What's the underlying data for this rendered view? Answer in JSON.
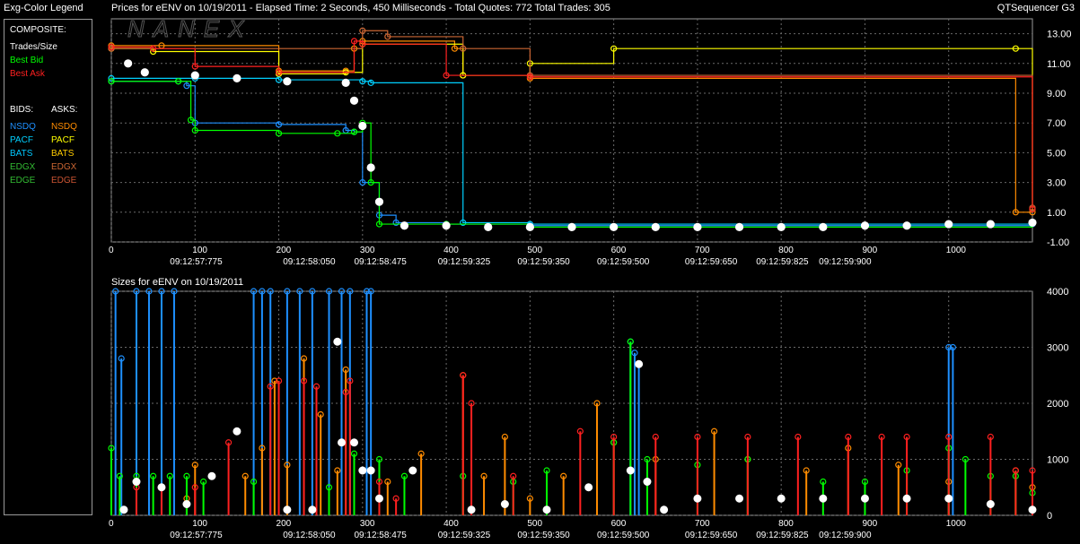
{
  "legend": {
    "title": "Exg-Color Legend",
    "composite_label": "COMPOSITE:",
    "trades_size": "Trades/Size",
    "best_bid": "Best Bid",
    "best_ask": "Best Ask",
    "bids_label": "BIDS:",
    "asks_label": "ASKS:",
    "bids": [
      "NSDQ",
      "PACF",
      "BATS",
      "EDGX",
      "EDGE"
    ],
    "asks": [
      "NSDQ",
      "PACF",
      "BATS",
      "EDGX",
      "EDGE"
    ],
    "colors": {
      "trades": "#ffffff",
      "best_bid": "#00ff00",
      "best_ask": "#ff2020",
      "bid_colors": [
        "#1e90ff",
        "#00d0ff",
        "#00c8ff",
        "#33bb33",
        "#33bb33"
      ],
      "ask_colors": [
        "#ff8c00",
        "#ffff00",
        "#ffcc00",
        "#cc6633",
        "#cc5533"
      ]
    }
  },
  "header": {
    "prices_title": "Prices for  eENV  on  10/19/2011   -  Elapsed Time: 2 Seconds, 450 Milliseconds   -  Total Quotes: 772  Total Trades: 305",
    "app_name": "QTSequencer G3"
  },
  "chart_data": [
    {
      "type": "line",
      "title": "Prices for  eENV  on  10/19/2011",
      "watermark": "NANEX",
      "xlim": [
        0,
        1100
      ],
      "ylim": [
        -1,
        14
      ],
      "y_ticks": [
        "13.00",
        "11.00",
        "9.00",
        "7.00",
        "5.00",
        "3.00",
        "1.00",
        "-1.00"
      ],
      "y_tick_values": [
        13,
        11,
        9,
        7,
        5,
        3,
        1,
        -1
      ],
      "x_ticks": [
        0,
        100,
        200,
        300,
        400,
        500,
        600,
        700,
        800,
        900,
        1000
      ],
      "time_labels": [
        {
          "x": 70,
          "label": "09:12:57:775"
        },
        {
          "x": 205,
          "label": "09:12:58:050"
        },
        {
          "x": 290,
          "label": "09:12:58:475"
        },
        {
          "x": 390,
          "label": "09:12:59:325"
        },
        {
          "x": 485,
          "label": "09:12:59:350"
        },
        {
          "x": 580,
          "label": "09:12:59:500"
        },
        {
          "x": 685,
          "label": "09:12:59:650"
        },
        {
          "x": 770,
          "label": "09:12:59:825"
        },
        {
          "x": 845,
          "label": "09:12:59:900"
        }
      ],
      "series": [
        {
          "name": "NSDQ Ask",
          "color": "#ff8c00",
          "x": [
            0,
            60,
            200,
            280,
            290,
            300,
            410,
            420,
            500,
            1080,
            1100
          ],
          "y": [
            12.2,
            12.2,
            10.5,
            10.5,
            12.0,
            12.5,
            12.0,
            10.2,
            10.0,
            1.0,
            1.0
          ]
        },
        {
          "name": "PACF Ask",
          "color": "#ffff00",
          "x": [
            0,
            50,
            200,
            280,
            300,
            420,
            500,
            600,
            1080,
            1100
          ],
          "y": [
            12.0,
            11.8,
            10.3,
            10.4,
            12.3,
            10.2,
            11.0,
            12.0,
            12.0,
            1.2
          ]
        },
        {
          "name": "EDGX Ask",
          "color": "#cc6633",
          "x": [
            0,
            300,
            330,
            420,
            500,
            1100
          ],
          "y": [
            12.0,
            13.2,
            12.8,
            12.0,
            10.2,
            1.3
          ]
        },
        {
          "name": "NSDQ Bid",
          "color": "#1e90ff",
          "x": [
            0,
            80,
            90,
            100,
            200,
            280,
            290,
            300,
            320,
            340,
            400,
            500,
            1100
          ],
          "y": [
            9.8,
            9.8,
            9.5,
            7.0,
            6.9,
            6.5,
            6.4,
            3.0,
            0.8,
            0.3,
            0.2,
            0.1,
            0.2
          ]
        },
        {
          "name": "PACF Bid",
          "color": "#00d0ff",
          "x": [
            0,
            100,
            200,
            300,
            310,
            420,
            500,
            1100
          ],
          "y": [
            10.0,
            10.0,
            9.9,
            9.8,
            9.7,
            0.3,
            0.2,
            0.3
          ]
        },
        {
          "name": "Best Bid",
          "color": "#00ff00",
          "x": [
            0,
            80,
            95,
            100,
            200,
            270,
            290,
            300,
            310,
            320,
            400,
            500,
            1100
          ],
          "y": [
            9.8,
            9.8,
            7.2,
            6.5,
            6.3,
            6.3,
            6.4,
            7.0,
            3.0,
            0.2,
            0.2,
            0.0,
            0.3
          ]
        },
        {
          "name": "Best Ask",
          "color": "#ff2020",
          "x": [
            0,
            50,
            100,
            200,
            290,
            300,
            400,
            500,
            1100
          ],
          "y": [
            12.1,
            12.0,
            10.8,
            10.4,
            12.5,
            12.3,
            10.2,
            10.1,
            1.2
          ]
        },
        {
          "name": "Trades",
          "color": "#ffffff",
          "x": [
            20,
            40,
            100,
            150,
            210,
            280,
            290,
            300,
            310,
            320,
            350,
            400,
            450,
            500,
            550,
            600,
            650,
            700,
            750,
            800,
            850,
            900,
            950,
            1000,
            1050,
            1100
          ],
          "y": [
            11.0,
            10.4,
            10.2,
            10.0,
            9.8,
            9.7,
            8.5,
            6.8,
            4.0,
            1.7,
            0.1,
            0.1,
            0.0,
            0.0,
            0.0,
            0.0,
            0.0,
            0.0,
            0.0,
            0.0,
            0.0,
            0.1,
            0.1,
            0.2,
            0.2,
            0.3
          ]
        }
      ]
    },
    {
      "type": "bar",
      "title": "Sizes for  eENV  on  10/19/2011",
      "xlim": [
        0,
        1100
      ],
      "ylim": [
        0,
        4000
      ],
      "y_ticks": [
        "4000",
        "3000",
        "2000",
        "1000",
        "0"
      ],
      "y_tick_values": [
        4000,
        3000,
        2000,
        1000,
        0
      ],
      "x_ticks": [
        0,
        100,
        200,
        300,
        400,
        500,
        600,
        700,
        800,
        900,
        1000
      ],
      "time_labels": [
        {
          "x": 70,
          "label": "09:12:57:775"
        },
        {
          "x": 205,
          "label": "09:12:58:050"
        },
        {
          "x": 290,
          "label": "09:12:58:475"
        },
        {
          "x": 390,
          "label": "09:12:59:325"
        },
        {
          "x": 485,
          "label": "09:12:59:350"
        },
        {
          "x": 580,
          "label": "09:12:59:500"
        },
        {
          "x": 685,
          "label": "09:12:59:650"
        },
        {
          "x": 770,
          "label": "09:12:59:825"
        },
        {
          "x": 845,
          "label": "09:12:59:900"
        }
      ],
      "series": [
        {
          "name": "NSDQ Bid Size",
          "color": "#1e90ff",
          "x": [
            5,
            12,
            30,
            45,
            60,
            75,
            170,
            180,
            190,
            210,
            225,
            240,
            260,
            275,
            285,
            305,
            310,
            620,
            625,
            630,
            1000,
            1005
          ],
          "y": [
            4000,
            2800,
            4000,
            4000,
            4000,
            4000,
            4000,
            4000,
            4000,
            4000,
            4000,
            4000,
            4000,
            4000,
            4000,
            4000,
            4000,
            3100,
            2900,
            2700,
            3000,
            3000
          ]
        },
        {
          "name": "NSDQ Ask Size",
          "color": "#ff8c00",
          "x": [
            90,
            100,
            160,
            180,
            195,
            210,
            230,
            250,
            270,
            280,
            330,
            370,
            420,
            445,
            470,
            500,
            540,
            580,
            600,
            650,
            720,
            760,
            830,
            880,
            940,
            1000,
            1080,
            1100
          ],
          "y": [
            300,
            900,
            700,
            1200,
            2400,
            900,
            2800,
            1800,
            800,
            2600,
            600,
            1100,
            2500,
            700,
            1400,
            300,
            700,
            2000,
            1300,
            1000,
            1500,
            1000,
            800,
            1200,
            900,
            600,
            800,
            500
          ]
        },
        {
          "name": "Best Bid Size",
          "color": "#00ff00",
          "x": [
            0,
            10,
            30,
            50,
            70,
            90,
            110,
            170,
            260,
            290,
            320,
            350,
            420,
            480,
            520,
            600,
            620,
            640,
            700,
            760,
            850,
            900,
            950,
            1000,
            1020,
            1050,
            1080,
            1100
          ],
          "y": [
            1200,
            700,
            700,
            700,
            700,
            700,
            600,
            600,
            500,
            1100,
            1000,
            700,
            700,
            600,
            800,
            1300,
            3100,
            1000,
            900,
            1000,
            600,
            600,
            800,
            1200,
            1000,
            700,
            700,
            400
          ]
        },
        {
          "name": "Best Ask Size",
          "color": "#ff2020",
          "x": [
            30,
            60,
            100,
            140,
            190,
            200,
            230,
            245,
            280,
            285,
            320,
            340,
            420,
            430,
            480,
            560,
            600,
            650,
            700,
            760,
            820,
            880,
            920,
            950,
            1000,
            1050,
            1080,
            1100
          ],
          "y": [
            500,
            500,
            500,
            1300,
            2300,
            2400,
            2400,
            2300,
            2200,
            2400,
            600,
            300,
            2500,
            2000,
            700,
            1500,
            1400,
            1400,
            1400,
            1400,
            1400,
            1400,
            1400,
            1400,
            1400,
            1400,
            800,
            800
          ]
        },
        {
          "name": "Trade Size",
          "color": "#ffffff",
          "x": [
            15,
            30,
            60,
            90,
            120,
            150,
            210,
            240,
            270,
            275,
            290,
            300,
            310,
            320,
            360,
            430,
            470,
            520,
            570,
            620,
            630,
            640,
            660,
            700,
            750,
            800,
            850,
            900,
            950,
            1000,
            1050,
            1100
          ],
          "y": [
            100,
            600,
            500,
            200,
            700,
            1500,
            100,
            100,
            3100,
            1300,
            1300,
            800,
            800,
            300,
            800,
            100,
            200,
            100,
            500,
            800,
            2700,
            600,
            100,
            300,
            300,
            300,
            300,
            300,
            300,
            300,
            200,
            100
          ]
        }
      ]
    }
  ],
  "lower_title": "Sizes for  eENV  on  10/19/2011"
}
